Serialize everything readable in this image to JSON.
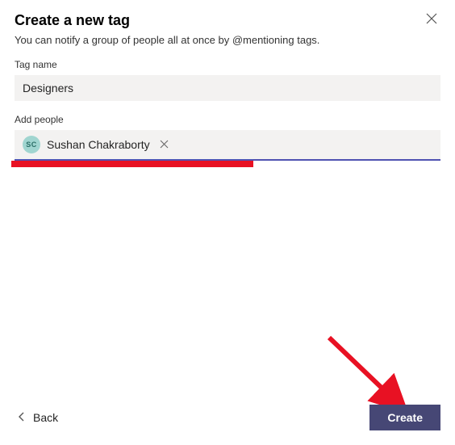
{
  "dialog": {
    "title": "Create a new tag",
    "subtitle": "You can notify a group of people all at once by @mentioning tags.",
    "close_label": "Close"
  },
  "tagName": {
    "label": "Tag name",
    "value": "Designers"
  },
  "addPeople": {
    "label": "Add people",
    "people": [
      {
        "initials": "SC",
        "name": "Sushan Chakraborty"
      }
    ]
  },
  "footer": {
    "back_label": "Back",
    "create_label": "Create"
  },
  "annotations": {
    "redbar_color": "#e81123",
    "arrow_color": "#e81123"
  }
}
